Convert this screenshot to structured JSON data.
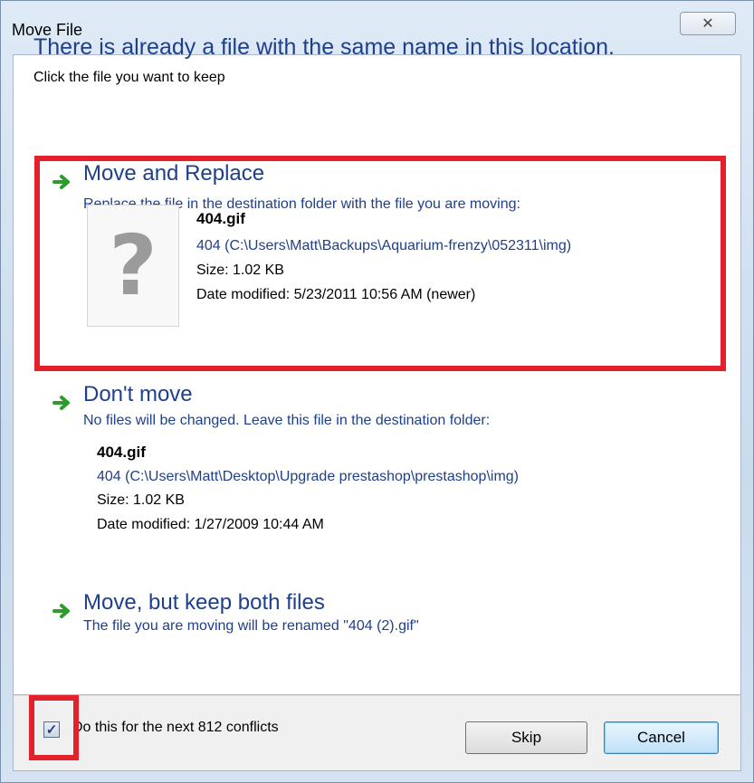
{
  "window": {
    "title": "Move File",
    "close_glyph": "✕"
  },
  "dialog": {
    "heading": "There is already a file with the same name in this location.",
    "subheading": "Click the file you want to keep"
  },
  "options": {
    "replace": {
      "title": "Move and Replace",
      "description": "Replace the file in the destination folder with the file you are moving:",
      "file_name": "404.gif",
      "file_path": "404 (C:\\Users\\Matt\\Backups\\Aquarium-frenzy\\052311\\img)",
      "size": "Size: 1.02 KB",
      "date": "Date modified: 5/23/2011 10:56 AM (newer)",
      "thumbnail_glyph": "?"
    },
    "dont_move": {
      "title": "Don't move",
      "description": "No files will be changed. Leave this file in the destination folder:",
      "file_name": "404.gif",
      "file_path": "404 (C:\\Users\\Matt\\Desktop\\Upgrade prestashop\\prestashop\\img)",
      "size": "Size: 1.02 KB",
      "date": "Date modified: 1/27/2009 10:44 AM"
    },
    "keep_both": {
      "title": "Move, but keep both files",
      "description": "The file you are moving will be renamed \"404 (2).gif\""
    }
  },
  "footer": {
    "checkbox_checked": true,
    "checkbox_glyph": "✓",
    "checkbox_label": "Do this for the next 812 conflicts",
    "skip_label": "Skip",
    "cancel_label": "Cancel"
  },
  "colors": {
    "accent_blue": "#1e3f8a",
    "highlight_red": "#e4202a",
    "arrow_green": "#2e9b2e"
  },
  "icons": [
    "green-arrow-icon",
    "question-mark-icon",
    "close-icon",
    "checkmark-icon"
  ]
}
